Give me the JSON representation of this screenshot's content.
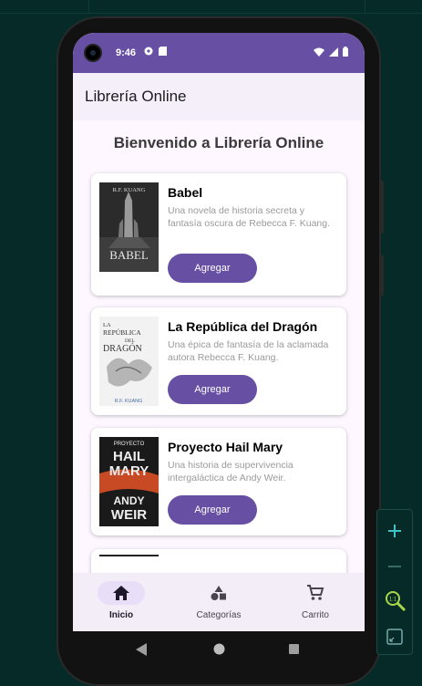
{
  "status_bar": {
    "time": "9:46"
  },
  "app_bar": {
    "title": "Librería Online"
  },
  "welcome": "Bienvenido a Librería Online",
  "books": [
    {
      "title": "Babel",
      "description": "Una novela de historia secreta y fantasía oscura de Rebecca F. Kuang.",
      "button": "Agregar",
      "cover": {
        "author": "R.F. KUANG",
        "title": "BABEL",
        "bg": "#2b2b2b"
      }
    },
    {
      "title": "La República del Dragón",
      "description": "Una épica de fantasía de la aclamada autora Rebecca F. Kuang.",
      "button": "Agregar",
      "cover": {
        "title_top": "LA",
        "title_mid": "REPÚBLICA",
        "title_del": "DEL",
        "title_bottom": "DRAGÓN",
        "author": "R.F. KUANG",
        "bg": "#f2f2f2"
      }
    },
    {
      "title": "Proyecto Hail Mary",
      "description": "Una historia de supervivencia intergaláctica de Andy Weir.",
      "button": "Agregar",
      "cover": {
        "top": "PROYECTO",
        "line1": "HAIL",
        "line2": "MARY",
        "author1": "ANDY",
        "author2": "WEIR",
        "bg": "#1a1a1a",
        "accent": "#e2592a"
      }
    }
  ],
  "bottom_nav": [
    {
      "label": "Inicio",
      "icon": "home-icon",
      "active": true
    },
    {
      "label": "Categorías",
      "icon": "category-icon",
      "active": false
    },
    {
      "label": "Carrito",
      "icon": "cart-icon",
      "active": false
    }
  ],
  "colors": {
    "primary": "#6750a4",
    "surface": "#fef7ff",
    "nav_pill": "#e8def8"
  },
  "emulator_tools": [
    "zoom-in-icon",
    "zoom-out-icon",
    "zoom-fit-icon",
    "resize-icon"
  ]
}
